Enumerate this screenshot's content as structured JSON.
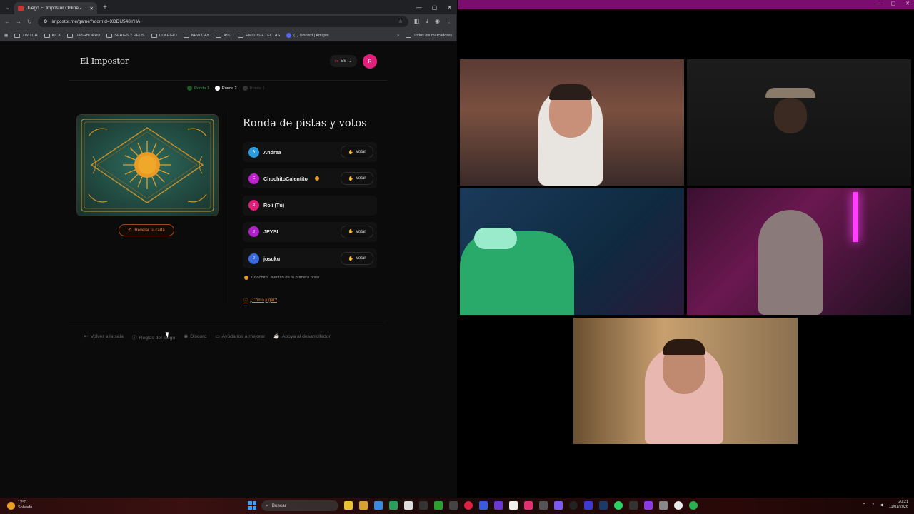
{
  "browser": {
    "tab_title": "Juego El Impostor Online - Jug…",
    "url": "impostor.me/game?roomId=XDDU548YHA",
    "bookmarks": [
      "TWITCH",
      "KICK",
      "DASHBOARD",
      "SERIES Y PELIS",
      "COLEGIO",
      "NEW DAY",
      "ASD",
      "EMOJIS + TECLAS",
      "(1) Discord | Amigos"
    ],
    "all_bookmarks": "Todos los marcadores"
  },
  "app": {
    "logo": "El Impostor",
    "lang": "ES",
    "lang_flag": "es",
    "user_initial": "R",
    "rounds": [
      "Ronda 1",
      "Ronda 2",
      "Ronda 3"
    ],
    "reveal_label": "Revelar tu carta",
    "section_title": "Ronda de pistas y votos",
    "players": [
      {
        "initial": "A",
        "name": "Andrea",
        "color": "#2b9be0",
        "vote": "Votar",
        "turn": false
      },
      {
        "initial": "C",
        "name": "ChochitoCalentito",
        "color": "#c020d0",
        "vote": "Votar",
        "turn": true
      },
      {
        "initial": "R",
        "name": "Roli (Tú)",
        "color": "#e0207a",
        "vote": "",
        "turn": false
      },
      {
        "initial": "J",
        "name": "JEYSI",
        "color": "#b020c8",
        "vote": "Votar",
        "turn": false
      },
      {
        "initial": "J",
        "name": "josuku",
        "color": "#3a6ae0",
        "vote": "Votar",
        "turn": false
      }
    ],
    "status": "ChochitoCalentito da la primera pista",
    "how_to": "¿Cómo jugar?",
    "footer": [
      "Volver a la sala",
      "Reglas del juego",
      "Discord",
      "Ayúdanos a mejorar",
      "Apoya al desarrollador"
    ]
  },
  "taskbar": {
    "temp": "12°C",
    "weather": "Soleado",
    "search": "Buscar",
    "time": "20:21",
    "date": "11/01/2026"
  },
  "colors": {
    "accent": "#e0802a",
    "brand": "#e0207a",
    "call_bg": "#7a0d6e"
  }
}
